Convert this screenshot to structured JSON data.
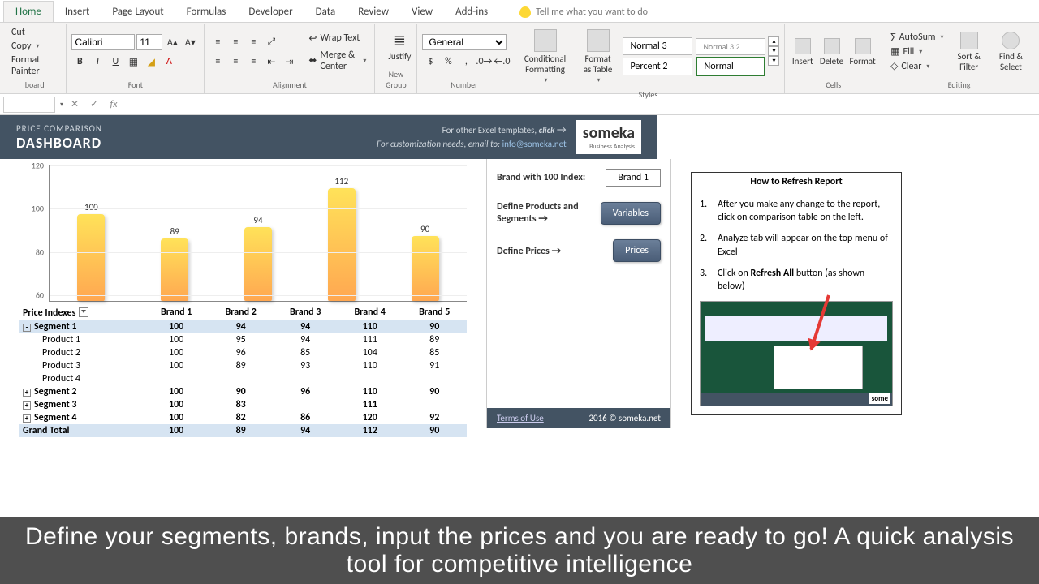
{
  "tabs": [
    "Home",
    "Insert",
    "Page Layout",
    "Formulas",
    "Developer",
    "Data",
    "Review",
    "View",
    "Add-ins"
  ],
  "tell_me": "Tell me what you want to do",
  "clipboard": {
    "cut": "Cut",
    "copy": "Copy",
    "painter": "Format Painter",
    "label": "board"
  },
  "font": {
    "name": "Calibri",
    "size": "11",
    "label": "Font"
  },
  "alignment": {
    "wrap": "Wrap Text",
    "merge": "Merge & Center",
    "justify": "Justify",
    "newgroup": "New Group",
    "label": "Alignment"
  },
  "number": {
    "format": "General",
    "label": "Number"
  },
  "styles": {
    "cond": "Conditional Formatting",
    "tbl": "Format as Table",
    "s1": "Normal 3",
    "s2": "Normal 3 2",
    "s3": "Percent 2",
    "s4": "Normal",
    "label": "Styles"
  },
  "cells": {
    "insert": "Insert",
    "delete": "Delete",
    "format": "Format",
    "label": "Cells"
  },
  "editing": {
    "sum": "AutoSum",
    "fill": "Fill",
    "clear": "Clear",
    "sort": "Sort & Filter",
    "find": "Find & Select",
    "label": "Editing"
  },
  "dashboard": {
    "t1": "PRICE COMPARISON",
    "t2": "DASHBOARD",
    "other": "For other Excel templates,",
    "click": "click",
    "custom": "For customization needs, email to:",
    "email": "info@someka.net",
    "logo": "someka",
    "logosub": "Business Analysis"
  },
  "chart_data": {
    "type": "bar",
    "categories": [
      "Brand 1",
      "Brand 2",
      "Brand 3",
      "Brand 4",
      "Brand 5"
    ],
    "values": [
      100,
      89,
      94,
      112,
      90
    ],
    "ylim": [
      60,
      120
    ],
    "ticks": [
      60,
      80,
      100,
      120
    ]
  },
  "table": {
    "header": [
      "Price Indexes",
      "Brand 1",
      "Brand 2",
      "Brand 3",
      "Brand 4",
      "Brand 5"
    ],
    "rows": [
      {
        "type": "seg",
        "exp": "-",
        "cells": [
          "Segment 1",
          "100",
          "94",
          "94",
          "110",
          "90"
        ],
        "sel": true
      },
      {
        "type": "prod",
        "cells": [
          "Product 1",
          "100",
          "95",
          "94",
          "111",
          "89"
        ]
      },
      {
        "type": "prod",
        "cells": [
          "Product 2",
          "100",
          "96",
          "85",
          "104",
          "85"
        ]
      },
      {
        "type": "prod",
        "cells": [
          "Product 3",
          "100",
          "89",
          "93",
          "110",
          "91"
        ]
      },
      {
        "type": "prod",
        "cells": [
          "Product 4",
          "",
          "",
          "",
          "",
          ""
        ]
      },
      {
        "type": "seg",
        "exp": "+",
        "cells": [
          "Segment 2",
          "100",
          "90",
          "96",
          "110",
          "90"
        ]
      },
      {
        "type": "seg",
        "exp": "+",
        "cells": [
          "Segment 3",
          "100",
          "83",
          "",
          "111",
          ""
        ]
      },
      {
        "type": "seg",
        "exp": "+",
        "cells": [
          "Segment 4",
          "100",
          "82",
          "86",
          "120",
          "92"
        ]
      },
      {
        "type": "gt",
        "cells": [
          "Grand Total",
          "100",
          "89",
          "94",
          "112",
          "90"
        ]
      }
    ]
  },
  "mid": {
    "idx_label": "Brand with 100 Index:",
    "idx_value": "Brand 1",
    "def_prod": "Define Products and Segments",
    "variables": "Variables",
    "def_prices": "Define Prices",
    "prices": "Prices",
    "terms": "Terms of Use",
    "copyright": "2016 © someka.net"
  },
  "how": {
    "title": "How to Refresh Report",
    "s1": "After you make any change to the report, click on comparison table on the left.",
    "s2": "Analyze tab will appear on the top menu of Excel",
    "s3a": "Click on ",
    "s3b": "Refresh All",
    "s3c": " button (as shown below)",
    "somi": "some"
  },
  "caption": "Define your segments, brands, input the prices and you are ready to go! A quick analysis tool for competitive intelligence"
}
